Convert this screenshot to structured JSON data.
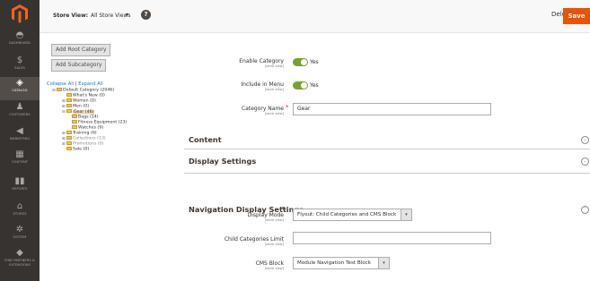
{
  "sidebar": {
    "items": [
      {
        "label": "DASHBOARD",
        "icon": "speedometer-icon"
      },
      {
        "label": "SALES",
        "icon": "dollar-icon"
      },
      {
        "label": "CATALOG",
        "icon": "box-icon"
      },
      {
        "label": "CUSTOMERS",
        "icon": "person-icon"
      },
      {
        "label": "MARKETING",
        "icon": "megaphone-icon"
      },
      {
        "label": "CONTENT",
        "icon": "layout-icon"
      },
      {
        "label": "REPORTS",
        "icon": "bar-chart-icon"
      },
      {
        "label": "STORES",
        "icon": "store-icon"
      },
      {
        "label": "SYSTEM",
        "icon": "gear-icon"
      },
      {
        "label": "FIND PARTNERS & EXTENSIONS",
        "icon": "cube-icon"
      }
    ],
    "active": "CATALOG"
  },
  "header": {
    "store_view_label": "Store View:",
    "store_view_value": "All Store Views",
    "delete_label": "Delete",
    "save_label": "Save",
    "help": "?"
  },
  "tree": {
    "add_root_label": "Add Root Category",
    "add_sub_label": "Add Subcategory",
    "collapse_all": "Collapse All",
    "expand_all": "Expand All",
    "separator": "|",
    "nodes": [
      {
        "label": "Default Category (2046)"
      },
      {
        "label": "What's New (0)"
      },
      {
        "label": "Women (0)"
      },
      {
        "label": "Men (0)"
      },
      {
        "label": "Gear (46)"
      },
      {
        "label": "Bags (14)"
      },
      {
        "label": "Fitness Equipment (23)"
      },
      {
        "label": "Watches (9)"
      },
      {
        "label": "Training (6)"
      },
      {
        "label": "Collections (13)"
      },
      {
        "label": "Promotions (0)"
      },
      {
        "label": "Sale (0)"
      }
    ]
  },
  "form": {
    "enable_category": {
      "label": "Enable Category",
      "scope": "[store view]",
      "value": "Yes"
    },
    "include_in_menu": {
      "label": "Include in Menu",
      "scope": "[store view]",
      "value": "Yes"
    },
    "category_name": {
      "label": "Category Name",
      "scope": "[store view]",
      "value": "Gear",
      "required": "*"
    }
  },
  "sections": {
    "content": "Content",
    "display_settings": "Display Settings",
    "navigation_display_settings": "Navigation Display Settings"
  },
  "navigation": {
    "display_mode": {
      "label": "Display Mode",
      "scope": "[store view]",
      "value": "Flyout: Child Categories and CMS Block"
    },
    "child_categories_limit": {
      "label": "Child Categories Limit",
      "scope": "[store view]",
      "value": ""
    },
    "cms_block": {
      "label": "CMS Block",
      "scope": "[store view]",
      "value": "Module Navigation Test Block"
    }
  },
  "colors": {
    "accent": "#eb5202",
    "sidebar_bg": "#373330",
    "toggle_on": "#79a22e",
    "link": "#1979c3"
  }
}
